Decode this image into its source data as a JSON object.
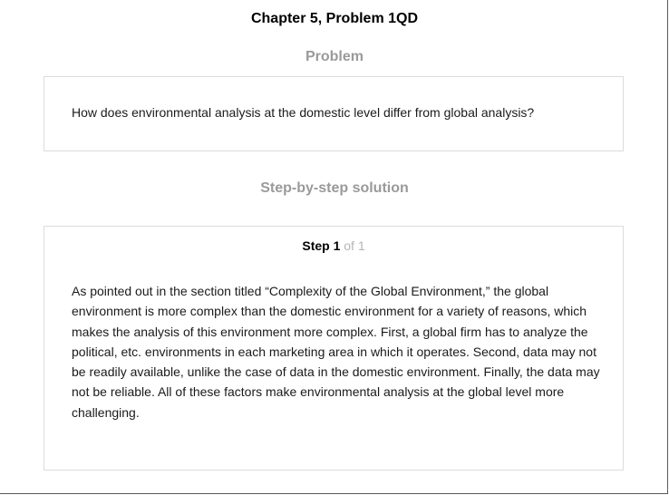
{
  "title": "Chapter 5, Problem 1QD",
  "problem": {
    "heading": "Problem",
    "text": "How does environmental analysis at the domestic level differ from global analysis?"
  },
  "solution": {
    "heading": "Step-by-step solution",
    "step_label": "Step 1",
    "step_of": "of 1",
    "text": "As pointed out in the section titled “Complexity of the Global Environment,” the global environment is more complex than the domestic environment for a variety of reasons, which makes the analysis of this environment more complex. First, a global firm has to analyze the political, etc. environments in each marketing area in which it operates. Second, data may not be readily available, unlike the case of data in the domestic environment. Finally, the data may not be reliable. All of these factors make environmental analysis at the global level more challenging."
  }
}
